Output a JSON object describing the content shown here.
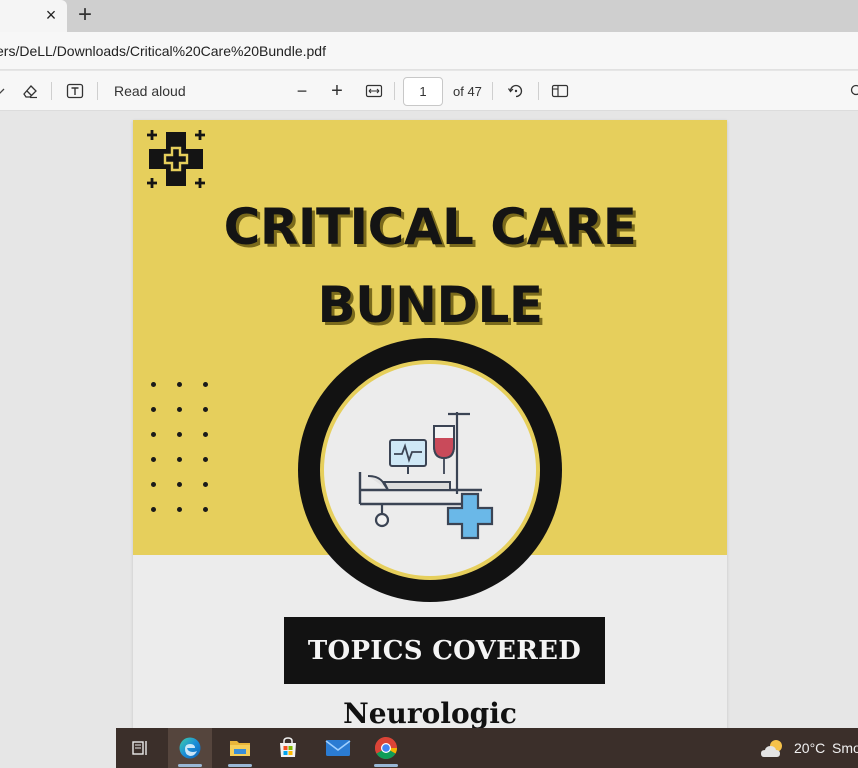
{
  "browser": {
    "url": "ers/DeLL/Downloads/Critical%20Care%20Bundle.pdf",
    "tab_close_glyph": "×",
    "new_tab_glyph": "+"
  },
  "pdf_toolbar": {
    "read_aloud_label": "Read aloud",
    "current_page": "1",
    "page_total": "of 47",
    "zoom_out_glyph": "−",
    "zoom_in_glyph": "+"
  },
  "document": {
    "title_line1": "CRITICAL CARE",
    "title_line2": "BUNDLE",
    "topics_heading": "TOPICS COVERED",
    "topics": [
      "Neurologic"
    ],
    "colors": {
      "accent_yellow": "#e6cf5c",
      "dark": "#121212",
      "page_bg": "#ececec",
      "blood_red": "#c94a5a",
      "cross_blue": "#6ab8e8"
    }
  },
  "taskbar": {
    "items": [
      "task-view-icon",
      "edge-icon",
      "file-explorer-icon",
      "microsoft-store-icon",
      "mail-icon",
      "chrome-icon"
    ],
    "active_item": "edge-icon",
    "weather_temp": "20°C",
    "weather_desc": "Smo"
  }
}
